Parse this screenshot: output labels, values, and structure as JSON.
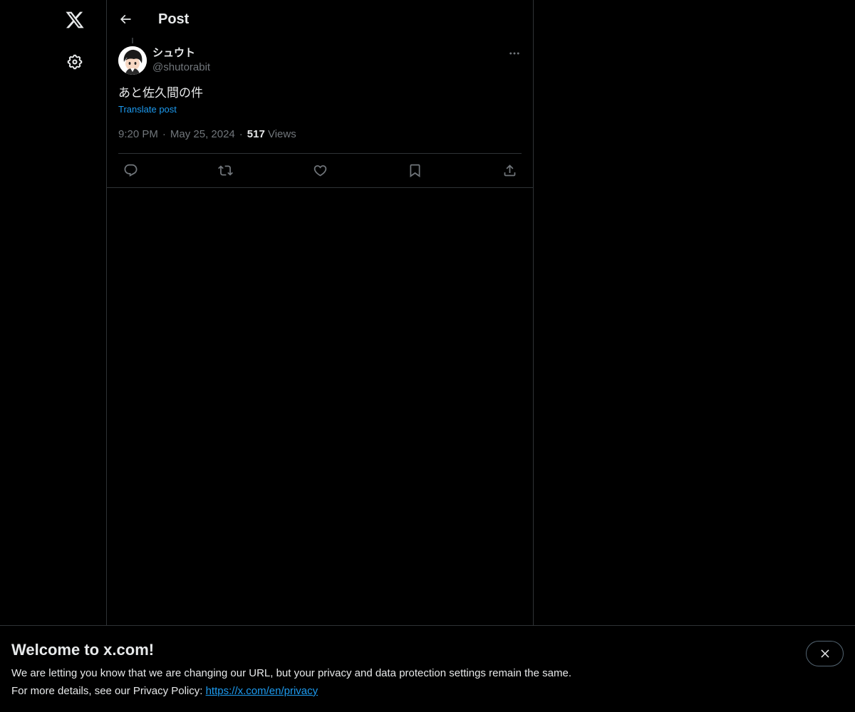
{
  "nav": {
    "logo_icon": "x-logo-icon",
    "settings_icon": "gear-icon"
  },
  "header": {
    "back_icon": "arrow-left-icon",
    "title": "Post"
  },
  "post": {
    "author": {
      "display_name": "シュウト",
      "handle": "@shutorabit",
      "avatar_icon": "avatar-image"
    },
    "more_icon": "ellipsis-icon",
    "text": "あと佐久間の件",
    "translate_label": "Translate post",
    "time": "9:20 PM",
    "date": "May 25, 2024",
    "separator": "·",
    "views_count": "517",
    "views_label": "Views",
    "actions": {
      "reply_icon": "reply-icon",
      "repost_icon": "repost-icon",
      "like_icon": "heart-icon",
      "bookmark_icon": "bookmark-icon",
      "share_icon": "share-icon"
    }
  },
  "banner": {
    "title": "Welcome to x.com!",
    "line1": "We are letting you know that we are changing our URL, but your privacy and data protection settings remain the same.",
    "line2_prefix": "For more details, see our Privacy Policy: ",
    "link_text": "https://x.com/en/privacy",
    "close_icon": "close-icon"
  },
  "colors": {
    "background": "#000000",
    "text_primary": "#e7e9ea",
    "text_secondary": "#71767b",
    "accent": "#1d9bf0",
    "border": "#2f3336"
  }
}
